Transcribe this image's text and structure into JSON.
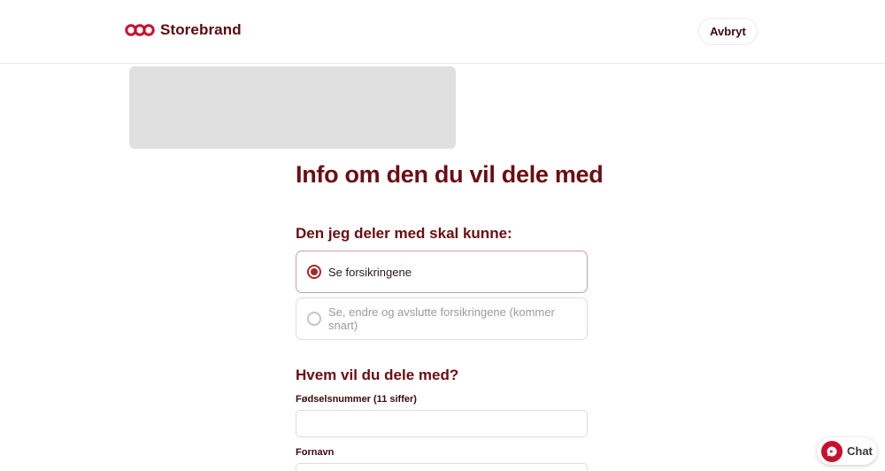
{
  "header": {
    "brand_name": "Storebrand",
    "cancel_label": "Avbryt"
  },
  "main": {
    "title": "Info om den du vil dele med",
    "permissions": {
      "heading": "Den jeg deler med skal kunne:",
      "options": [
        {
          "label": "Se forsikringene",
          "selected": true,
          "disabled": false
        },
        {
          "label": "Se, endre og avslutte forsikringene (kommer snart)",
          "selected": false,
          "disabled": true
        }
      ]
    },
    "recipient": {
      "heading": "Hvem vil du dele med?",
      "fields": [
        {
          "label": "Fødselsnummer (11 siffer)",
          "value": ""
        },
        {
          "label": "Fornavn",
          "value": ""
        }
      ]
    }
  },
  "chat": {
    "label": "Chat"
  },
  "colors": {
    "brand": "#c8102e",
    "heading": "#6b0d12",
    "radio_selected": "#a52a2a"
  }
}
